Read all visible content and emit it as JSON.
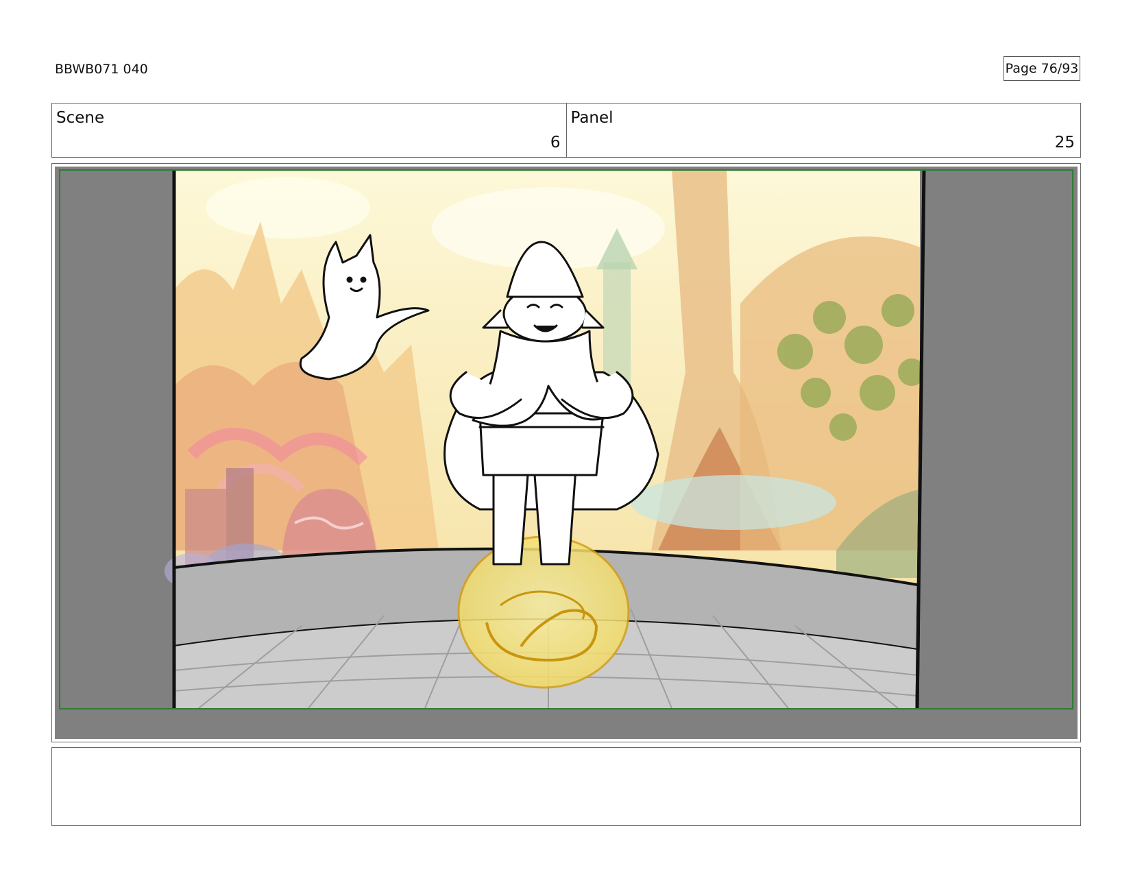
{
  "header": {
    "doc_id": "BBWB071 040",
    "page": "Page 76/93"
  },
  "scene": {
    "label": "Scene",
    "value": "6"
  },
  "panel": {
    "label": "Panel",
    "value": "25"
  },
  "colors": {
    "frame_gray": "#808080",
    "safe_area_green": "#2e7d32",
    "sky": "#fbf3c8",
    "pad_yellow": "#f5e27a",
    "pad_outline": "#d4a017",
    "wall_gray": "#b0b0b0",
    "floor_gray": "#cfcfcf"
  },
  "artwork": {
    "characters": [
      "bearded-gnome-icon",
      "floating-spirit-icon"
    ],
    "prop": "yellow-glow-pad-icon",
    "background": "colorful-village-background"
  },
  "caption": ""
}
